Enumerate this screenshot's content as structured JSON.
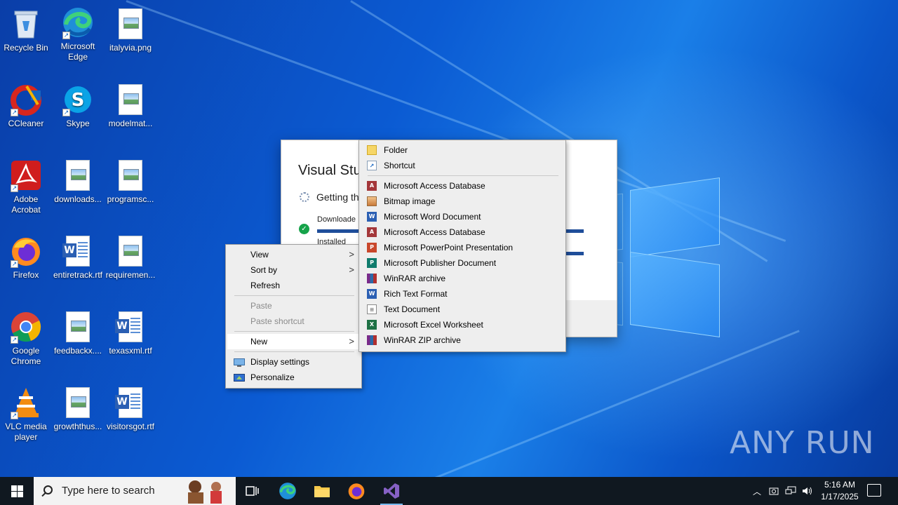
{
  "desktop": {
    "icons": [
      {
        "label": "Recycle Bin"
      },
      {
        "label": "Microsoft Edge"
      },
      {
        "label": "italyvia.png"
      },
      {
        "label": "CCleaner"
      },
      {
        "label": "Skype"
      },
      {
        "label": "modelmat..."
      },
      {
        "label": "Adobe Acrobat"
      },
      {
        "label": "downloads..."
      },
      {
        "label": "programsc..."
      },
      {
        "label": "Firefox"
      },
      {
        "label": "entiretrack.rtf"
      },
      {
        "label": "requiremen..."
      },
      {
        "label": "Google Chrome"
      },
      {
        "label": "feedbackx...."
      },
      {
        "label": "texasxml.rtf"
      },
      {
        "label": "VLC media player"
      },
      {
        "label": "growththus..."
      },
      {
        "label": "visitorsgot.rtf"
      }
    ]
  },
  "installer": {
    "title": "Visual Stu",
    "status": "Getting th",
    "downloaded_label": "Downloade",
    "installed_label": "Installed"
  },
  "context_menu": {
    "view": "View",
    "sort_by": "Sort by",
    "refresh": "Refresh",
    "paste": "Paste",
    "paste_shortcut": "Paste shortcut",
    "new": "New",
    "display_settings": "Display settings",
    "personalize": "Personalize"
  },
  "new_submenu": {
    "items": [
      {
        "label": "Folder",
        "icon": "folder-icon"
      },
      {
        "label": "Shortcut",
        "icon": "shortcut-icon"
      },
      {
        "label": "Microsoft Access Database",
        "icon": "access-icon"
      },
      {
        "label": "Bitmap image",
        "icon": "bitmap-icon"
      },
      {
        "label": "Microsoft Word Document",
        "icon": "word-icon"
      },
      {
        "label": "Microsoft Access Database",
        "icon": "access-icon"
      },
      {
        "label": "Microsoft PowerPoint Presentation",
        "icon": "powerpoint-icon"
      },
      {
        "label": "Microsoft Publisher Document",
        "icon": "publisher-icon"
      },
      {
        "label": "WinRAR archive",
        "icon": "winrar-icon"
      },
      {
        "label": "Rich Text Format",
        "icon": "rtf-icon"
      },
      {
        "label": "Text Document",
        "icon": "text-document-icon"
      },
      {
        "label": "Microsoft Excel Worksheet",
        "icon": "excel-icon"
      },
      {
        "label": "WinRAR ZIP archive",
        "icon": "winrar-zip-icon"
      }
    ]
  },
  "taskbar": {
    "search_placeholder": "Type here to search",
    "time": "5:16 AM",
    "date": "1/17/2025"
  },
  "watermark": "ANY RUN",
  "colors": {
    "accent": "#0a5fd0",
    "taskbar": "#101820",
    "menu_bg": "#eeeeee",
    "progress": "#1f4e9a"
  }
}
